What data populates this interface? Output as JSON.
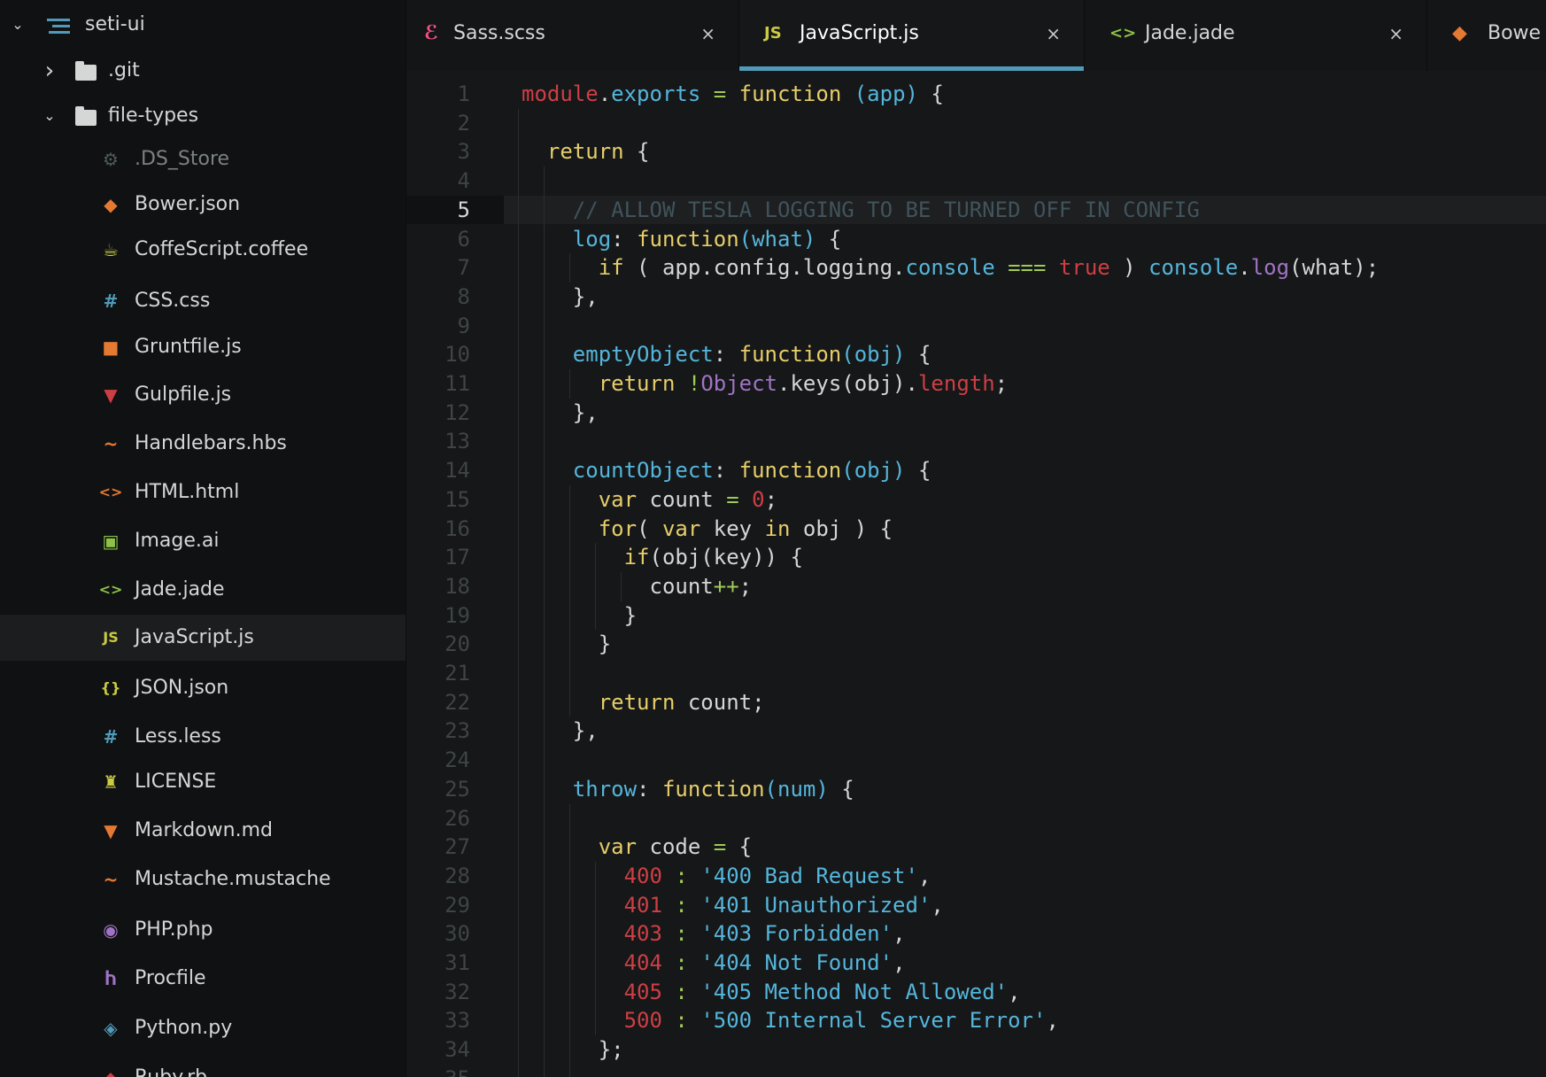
{
  "sidebar": {
    "root": {
      "label": "seti-ui",
      "expanded": true
    },
    "items": [
      {
        "label": ".git",
        "type": "folder",
        "expanded": false,
        "icon": "folder-icon"
      },
      {
        "label": "file-types",
        "type": "folder",
        "expanded": true,
        "icon": "folder-icon"
      },
      {
        "label": ".DS_Store",
        "icon": "gear-icon",
        "icon_glyph": "⚙",
        "color": "#4d5a5e"
      },
      {
        "label": "Bower.json",
        "icon": "bower-icon",
        "icon_glyph": "◆",
        "color": "#e37933"
      },
      {
        "label": "CoffeScript.coffee",
        "icon": "coffee-icon",
        "icon_glyph": "☕",
        "color": "#cbcb41"
      },
      {
        "label": "CSS.css",
        "icon": "css-hash-icon",
        "icon_glyph": "#",
        "color": "#519aba"
      },
      {
        "label": "Gruntfile.js",
        "icon": "grunt-icon",
        "icon_glyph": "■",
        "color": "#e37933"
      },
      {
        "label": "Gulpfile.js",
        "icon": "gulp-icon",
        "icon_glyph": "▼",
        "color": "#cc3e44"
      },
      {
        "label": "Handlebars.hbs",
        "icon": "mustache-icon",
        "icon_glyph": "~",
        "color": "#e37933"
      },
      {
        "label": "HTML.html",
        "icon": "html-icon",
        "icon_glyph": "<>",
        "color": "#e37933"
      },
      {
        "label": "Image.ai",
        "icon": "image-icon",
        "icon_glyph": "▣",
        "color": "#8dc149"
      },
      {
        "label": "Jade.jade",
        "icon": "jade-icon",
        "icon_glyph": "<>",
        "color": "#8dc149"
      },
      {
        "label": "JavaScript.js",
        "icon": "javascript-icon",
        "icon_glyph": "JS",
        "color": "#cbcb41",
        "selected": true
      },
      {
        "label": "JSON.json",
        "icon": "json-icon",
        "icon_glyph": "{}",
        "color": "#cbcb41"
      },
      {
        "label": "Less.less",
        "icon": "less-icon",
        "icon_glyph": "#",
        "color": "#519aba"
      },
      {
        "label": "LICENSE",
        "icon": "license-icon",
        "icon_glyph": "♜",
        "color": "#cbcb41"
      },
      {
        "label": "Markdown.md",
        "icon": "markdown-icon",
        "icon_glyph": "▼",
        "color": "#e37933"
      },
      {
        "label": "Mustache.mustache",
        "icon": "mustache-icon",
        "icon_glyph": "~",
        "color": "#e37933"
      },
      {
        "label": "PHP.php",
        "icon": "php-icon",
        "icon_glyph": "◉",
        "color": "#a074c4"
      },
      {
        "label": "Procfile",
        "icon": "procfile-icon",
        "icon_glyph": "Ⴙ",
        "color": "#a074c4"
      },
      {
        "label": "Python.py",
        "icon": "python-icon",
        "icon_glyph": "◈",
        "color": "#519aba"
      },
      {
        "label": "Ruby.rb",
        "icon": "ruby-icon",
        "icon_glyph": "◆",
        "color": "#cc3e44"
      }
    ]
  },
  "tabs": [
    {
      "label": "Sass.scss",
      "icon": "sass-icon",
      "icon_glyph": "ℰ",
      "color": "#f55385",
      "close": "×",
      "active": false
    },
    {
      "label": "JavaScript.js",
      "icon": "javascript-icon",
      "icon_glyph": "JS",
      "color": "#cbcb41",
      "close": "×",
      "active": true
    },
    {
      "label": "Jade.jade",
      "icon": "jade-icon",
      "icon_glyph": "<>",
      "color": "#8dc149",
      "close": "×",
      "active": false
    },
    {
      "label": "Bowe",
      "icon": "bower-icon",
      "icon_glyph": "◆",
      "color": "#e37933",
      "close": "",
      "active": false
    }
  ],
  "editor": {
    "current_line": 5,
    "lines": [
      [
        [
          "t-obj",
          "module"
        ],
        [
          "t-punc",
          "."
        ],
        [
          "t-prop",
          "exports"
        ],
        [
          "t-punc",
          " "
        ],
        [
          "t-op",
          "="
        ],
        [
          "t-punc",
          " "
        ],
        [
          "t-kw",
          "function"
        ],
        [
          "t-punc",
          " "
        ],
        [
          "t-param",
          "(app)"
        ],
        [
          "t-punc",
          " {"
        ]
      ],
      [],
      [
        [
          "t-punc",
          "  "
        ],
        [
          "t-kw",
          "return"
        ],
        [
          "t-punc",
          " {"
        ]
      ],
      [],
      [
        [
          "t-punc",
          "    "
        ],
        [
          "t-com",
          "// ALLOW TESLA LOGGING TO BE TURNED OFF IN CONFIG"
        ]
      ],
      [
        [
          "t-punc",
          "    "
        ],
        [
          "t-fn",
          "log"
        ],
        [
          "t-punc",
          ": "
        ],
        [
          "t-kw",
          "function"
        ],
        [
          "t-param",
          "(what)"
        ],
        [
          "t-punc",
          " {"
        ]
      ],
      [
        [
          "t-punc",
          "      "
        ],
        [
          "t-kw",
          "if"
        ],
        [
          "t-punc",
          " ( app.config.logging."
        ],
        [
          "t-prop",
          "console"
        ],
        [
          "t-punc",
          " "
        ],
        [
          "t-op",
          "==="
        ],
        [
          "t-punc",
          " "
        ],
        [
          "t-bool",
          "true"
        ],
        [
          "t-punc",
          " ) "
        ],
        [
          "t-prop",
          "console"
        ],
        [
          "t-punc",
          "."
        ],
        [
          "t-purple",
          "log"
        ],
        [
          "t-punc",
          "(what);"
        ]
      ],
      [
        [
          "t-punc",
          "    },"
        ]
      ],
      [],
      [
        [
          "t-punc",
          "    "
        ],
        [
          "t-fn",
          "emptyObject"
        ],
        [
          "t-punc",
          ": "
        ],
        [
          "t-kw",
          "function"
        ],
        [
          "t-param",
          "(obj)"
        ],
        [
          "t-punc",
          " {"
        ]
      ],
      [
        [
          "t-punc",
          "      "
        ],
        [
          "t-kw",
          "return"
        ],
        [
          "t-punc",
          " "
        ],
        [
          "t-op",
          "!"
        ],
        [
          "t-purple",
          "Object"
        ],
        [
          "t-punc",
          ".keys(obj)."
        ],
        [
          "t-obj",
          "length"
        ],
        [
          "t-punc",
          ";"
        ]
      ],
      [
        [
          "t-punc",
          "    },"
        ]
      ],
      [],
      [
        [
          "t-punc",
          "    "
        ],
        [
          "t-fn",
          "countObject"
        ],
        [
          "t-punc",
          ": "
        ],
        [
          "t-kw",
          "function"
        ],
        [
          "t-param",
          "(obj)"
        ],
        [
          "t-punc",
          " {"
        ]
      ],
      [
        [
          "t-punc",
          "      "
        ],
        [
          "t-kw",
          "var"
        ],
        [
          "t-punc",
          " count "
        ],
        [
          "t-op",
          "="
        ],
        [
          "t-punc",
          " "
        ],
        [
          "t-num",
          "0"
        ],
        [
          "t-punc",
          ";"
        ]
      ],
      [
        [
          "t-punc",
          "      "
        ],
        [
          "t-kw",
          "for"
        ],
        [
          "t-punc",
          "( "
        ],
        [
          "t-kw",
          "var"
        ],
        [
          "t-punc",
          " key "
        ],
        [
          "t-kw",
          "in"
        ],
        [
          "t-punc",
          " obj ) {"
        ]
      ],
      [
        [
          "t-punc",
          "        "
        ],
        [
          "t-kw",
          "if"
        ],
        [
          "t-punc",
          "(obj(key)) {"
        ]
      ],
      [
        [
          "t-punc",
          "          count"
        ],
        [
          "t-op",
          "++"
        ],
        [
          "t-punc",
          ";"
        ]
      ],
      [
        [
          "t-punc",
          "        }"
        ]
      ],
      [
        [
          "t-punc",
          "      }"
        ]
      ],
      [],
      [
        [
          "t-punc",
          "      "
        ],
        [
          "t-kw",
          "return"
        ],
        [
          "t-punc",
          " count;"
        ]
      ],
      [
        [
          "t-punc",
          "    },"
        ]
      ],
      [],
      [
        [
          "t-punc",
          "    "
        ],
        [
          "t-fn",
          "throw"
        ],
        [
          "t-punc",
          ": "
        ],
        [
          "t-kw",
          "function"
        ],
        [
          "t-param",
          "(num)"
        ],
        [
          "t-punc",
          " {"
        ]
      ],
      [],
      [
        [
          "t-punc",
          "      "
        ],
        [
          "t-kw",
          "var"
        ],
        [
          "t-punc",
          " code "
        ],
        [
          "t-op",
          "="
        ],
        [
          "t-punc",
          " {"
        ]
      ],
      [
        [
          "t-punc",
          "        "
        ],
        [
          "t-key",
          "400"
        ],
        [
          "t-punc",
          " "
        ],
        [
          "t-op",
          ":"
        ],
        [
          "t-punc",
          " "
        ],
        [
          "t-str",
          "'400 Bad Request'"
        ],
        [
          "t-punc",
          ","
        ]
      ],
      [
        [
          "t-punc",
          "        "
        ],
        [
          "t-key",
          "401"
        ],
        [
          "t-punc",
          " "
        ],
        [
          "t-op",
          ":"
        ],
        [
          "t-punc",
          " "
        ],
        [
          "t-str",
          "'401 Unauthorized'"
        ],
        [
          "t-punc",
          ","
        ]
      ],
      [
        [
          "t-punc",
          "        "
        ],
        [
          "t-key",
          "403"
        ],
        [
          "t-punc",
          " "
        ],
        [
          "t-op",
          ":"
        ],
        [
          "t-punc",
          " "
        ],
        [
          "t-str",
          "'403 Forbidden'"
        ],
        [
          "t-punc",
          ","
        ]
      ],
      [
        [
          "t-punc",
          "        "
        ],
        [
          "t-key",
          "404"
        ],
        [
          "t-punc",
          " "
        ],
        [
          "t-op",
          ":"
        ],
        [
          "t-punc",
          " "
        ],
        [
          "t-str",
          "'404 Not Found'"
        ],
        [
          "t-punc",
          ","
        ]
      ],
      [
        [
          "t-punc",
          "        "
        ],
        [
          "t-key",
          "405"
        ],
        [
          "t-punc",
          " "
        ],
        [
          "t-op",
          ":"
        ],
        [
          "t-punc",
          " "
        ],
        [
          "t-str",
          "'405 Method Not Allowed'"
        ],
        [
          "t-punc",
          ","
        ]
      ],
      [
        [
          "t-punc",
          "        "
        ],
        [
          "t-key",
          "500"
        ],
        [
          "t-punc",
          " "
        ],
        [
          "t-op",
          ":"
        ],
        [
          "t-punc",
          " "
        ],
        [
          "t-str",
          "'500 Internal Server Error'"
        ],
        [
          "t-punc",
          ","
        ]
      ],
      [
        [
          "t-punc",
          "      };"
        ]
      ],
      []
    ]
  }
}
